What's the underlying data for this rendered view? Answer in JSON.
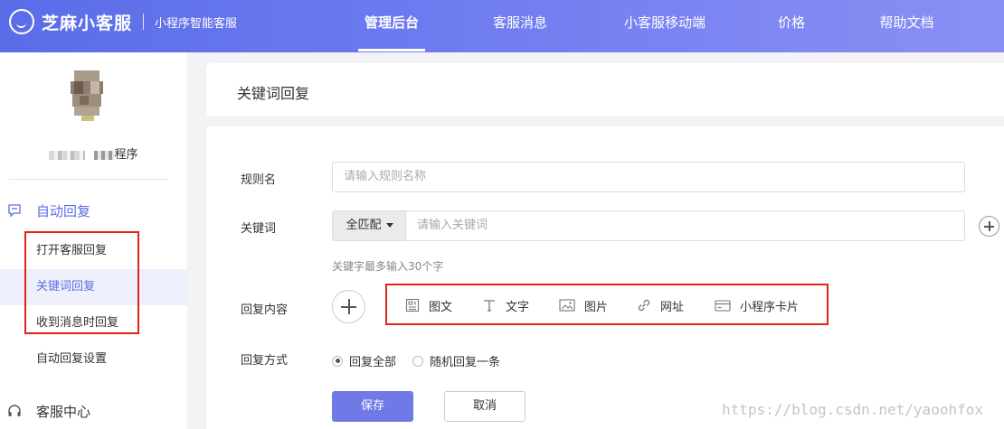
{
  "brand": {
    "name": "芝麻小客服",
    "subtitle": "小程序智能客服"
  },
  "nav": [
    {
      "label": "管理后台",
      "active": true
    },
    {
      "label": "客服消息"
    },
    {
      "label": "小客服移动端"
    },
    {
      "label": "价格"
    },
    {
      "label": "帮助文档"
    }
  ],
  "sidebar": {
    "account_suffix": "程序",
    "auto_reply": {
      "label": "自动回复",
      "icon": "message-icon"
    },
    "items": [
      {
        "label": "打开客服回复"
      },
      {
        "label": "关键词回复",
        "active": true
      },
      {
        "label": "收到消息时回复"
      },
      {
        "label": "自动回复设置"
      }
    ],
    "service_center": {
      "label": "客服中心",
      "icon": "headset-icon"
    }
  },
  "page": {
    "title": "关键词回复"
  },
  "form": {
    "rule_name": {
      "label": "规则名",
      "placeholder": "请输入规则名称"
    },
    "keyword": {
      "label": "关键词",
      "match_mode": "全匹配",
      "placeholder": "请输入关键词",
      "hint": "关键字最多输入30个字"
    },
    "reply_content": {
      "label": "回复内容",
      "types": [
        {
          "label": "图文",
          "icon": "article-icon"
        },
        {
          "label": "文字",
          "icon": "text-icon"
        },
        {
          "label": "图片",
          "icon": "image-icon"
        },
        {
          "label": "网址",
          "icon": "link-icon"
        },
        {
          "label": "小程序卡片",
          "icon": "card-icon"
        }
      ]
    },
    "reply_mode": {
      "label": "回复方式",
      "options": [
        {
          "label": "回复全部",
          "selected": true
        },
        {
          "label": "随机回复一条"
        }
      ]
    },
    "save_label": "保存",
    "cancel_label": "取消"
  },
  "watermark": "https://blog.csdn.net/yaoohfox",
  "colors": {
    "accent": "#6f7ae6",
    "highlight": "#e2231a"
  }
}
